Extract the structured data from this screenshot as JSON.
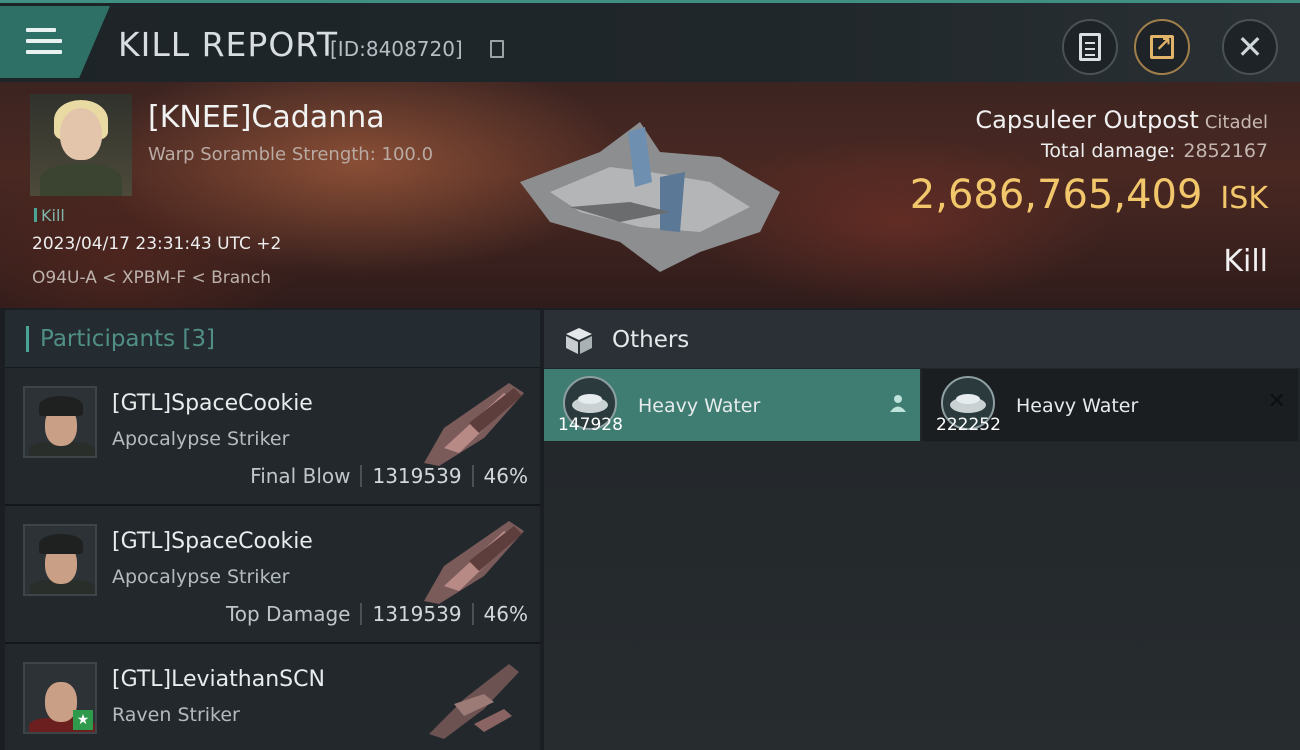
{
  "header": {
    "title": "KILL REPORT",
    "report_id": "[ID:8408720]"
  },
  "victim": {
    "name": "[KNEE]Cadanna",
    "subtitle": "Warp Soramble Strength: 100.0",
    "tag": "Kill",
    "datetime": "2023/04/17 23:31:43 UTC +2",
    "location": "O94U-A < XPBM-F < Branch",
    "structure_name": "Capsuleer Outpost",
    "structure_class": "Citadel",
    "total_damage_label": "Total damage:",
    "total_damage": "2852167",
    "isk_value": "2,686,765,409",
    "isk_unit": "ISK",
    "result": "Kill"
  },
  "participants": {
    "title": "Participants [3]",
    "rows": [
      {
        "name": "[GTL]SpaceCookie",
        "ship": "Apocalypse Striker",
        "role": "Final Blow",
        "damage": "1319539",
        "percent": "46%"
      },
      {
        "name": "[GTL]SpaceCookie",
        "ship": "Apocalypse Striker",
        "role": "Top Damage",
        "damage": "1319539",
        "percent": "46%"
      },
      {
        "name": "[GTL]LeviathanSCN",
        "ship": "Raven Striker",
        "role": "",
        "damage": "",
        "percent": ""
      }
    ]
  },
  "others": {
    "title": "Others",
    "items": [
      {
        "name": "Heavy Water",
        "quantity": "147928"
      },
      {
        "name": "Heavy Water",
        "quantity": "222252"
      }
    ]
  },
  "colors": {
    "accent": "#4aa596",
    "isk": "#f2c76b",
    "selected_item": "#3f7d72"
  },
  "icons": [
    "menu-icon",
    "copy-icon",
    "clipboard-icon",
    "share-icon",
    "close-icon",
    "cube-icon",
    "person-icon",
    "heavy-water-icon"
  ]
}
